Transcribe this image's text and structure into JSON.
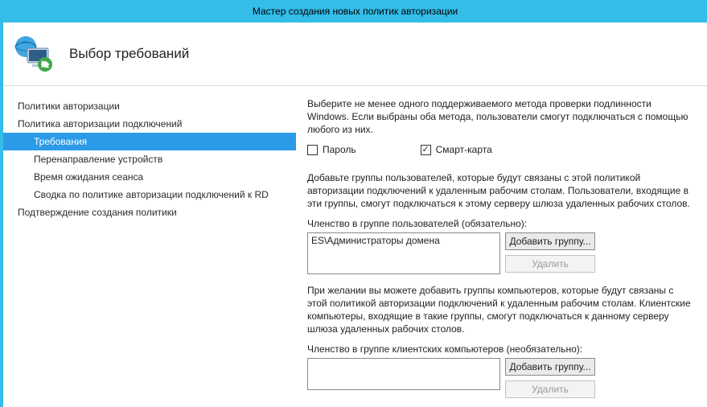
{
  "window": {
    "title": "Мастер создания новых политик авторизации"
  },
  "header": {
    "title": "Выбор требований"
  },
  "sidebar": {
    "items": [
      {
        "label": "Политики авторизации",
        "level": 0,
        "selected": false
      },
      {
        "label": "Политика авторизации подключений",
        "level": 0,
        "selected": false
      },
      {
        "label": "Требования",
        "level": 1,
        "selected": true
      },
      {
        "label": "Перенаправление устройств",
        "level": 1,
        "selected": false
      },
      {
        "label": "Время ожидания сеанса",
        "level": 1,
        "selected": false
      },
      {
        "label": "Сводка по политике авторизации подключений к RD",
        "level": 1,
        "selected": false
      },
      {
        "label": "Подтверждение создания политики",
        "level": 0,
        "selected": false
      }
    ]
  },
  "main": {
    "auth_instruction": "Выберите не менее одного поддерживаемого метода проверки подлинности Windows. Если выбраны оба метода, пользователи смогут подключаться с помощью любого из них.",
    "password_label": "Пароль",
    "password_checked": false,
    "smartcard_label": "Смарт-карта",
    "smartcard_checked": true,
    "user_groups_instruction": "Добавьте группы пользователей, которые будут связаны с этой политикой авторизации подключений к удаленным рабочим столам. Пользователи, входящие в эти группы, смогут подключаться к этому серверу шлюза удаленных рабочих столов.",
    "user_groups_label": "Членство в группе пользователей (обязательно):",
    "user_groups_value": "ES\\Администраторы домена",
    "computer_groups_instruction": "При желании вы можете добавить группы компьютеров, которые будут связаны с этой политикой авторизации подключений к удаленным рабочим столам. Клиентские компьютеры, входящие в такие группы, смогут подключаться к данному серверу шлюза удаленных рабочих столов.",
    "computer_groups_label": "Членство в группе клиентских компьютеров (необязательно):",
    "computer_groups_value": "",
    "add_group_label": "Добавить группу...",
    "remove_label": "Удалить"
  }
}
